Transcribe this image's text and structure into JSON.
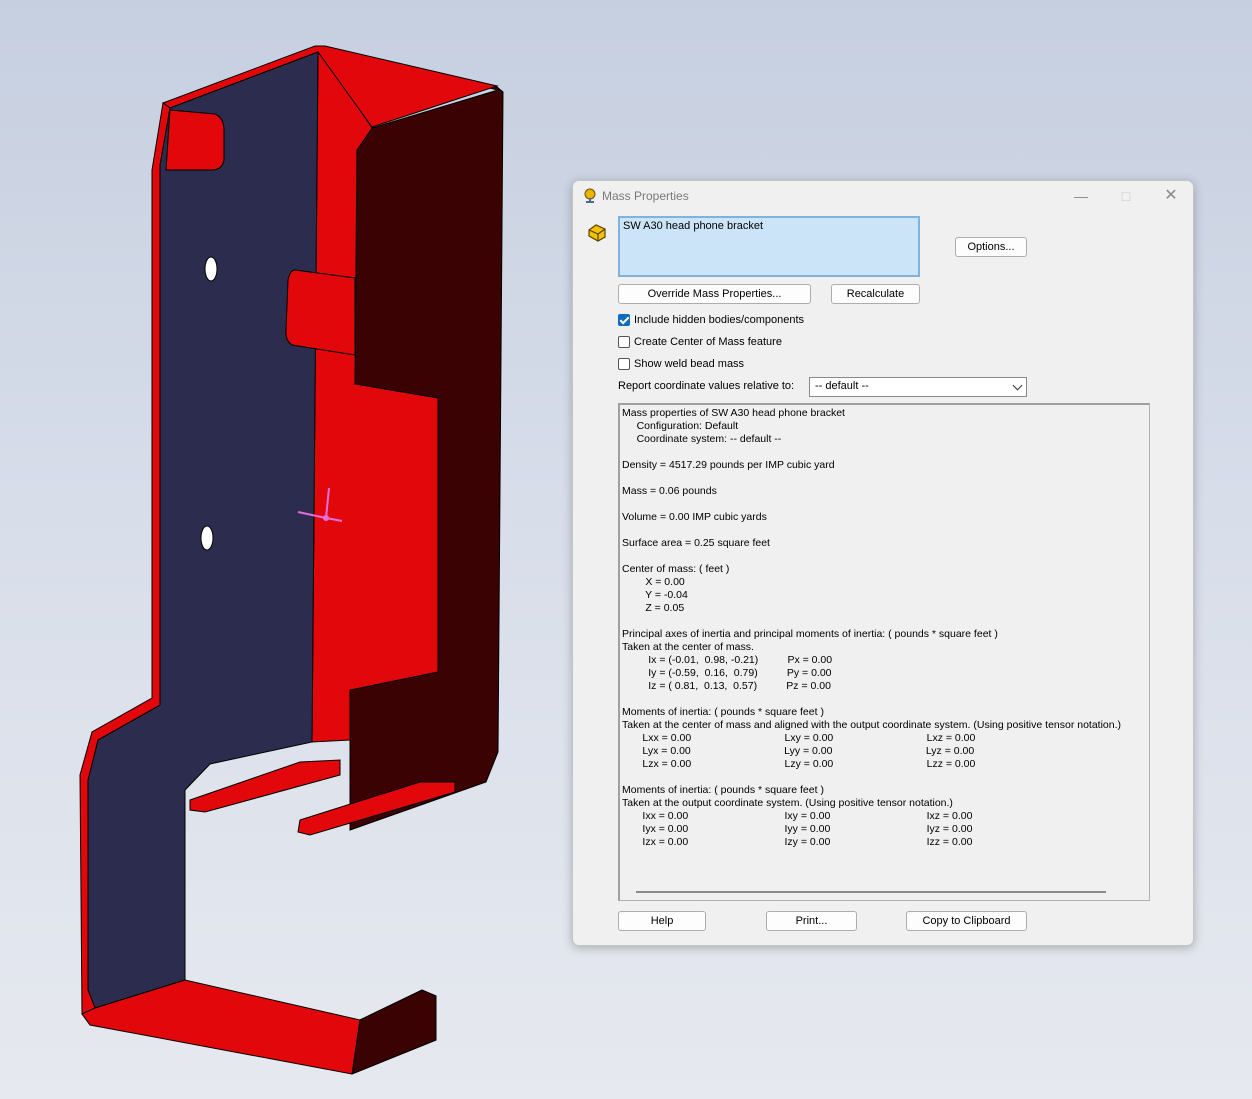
{
  "colors": {
    "part_face_red": "#e2070a",
    "part_face_dark": "#2c2c4e",
    "part_shadow": "#3a0203",
    "checkbox_accent": "#0f6cbd",
    "name_box_bg": "#cce4f7"
  },
  "window": {
    "title": "Mass Properties",
    "icons": {
      "title": "scale-icon",
      "minimize": "minimize-icon",
      "maximize": "maximize-icon",
      "close": "close-icon"
    }
  },
  "selection": {
    "icon": "part-icon",
    "items": [
      "SW A30 head phone bracket"
    ]
  },
  "buttons": {
    "options": "Options...",
    "override": "Override Mass Properties...",
    "recalculate": "Recalculate",
    "help": "Help",
    "print": "Print...",
    "copy": "Copy to Clipboard"
  },
  "options": {
    "include_hidden": {
      "label": "Include hidden bodies/components",
      "checked": true
    },
    "create_com": {
      "label": "Create Center of Mass feature",
      "checked": false
    },
    "weld_bead": {
      "label": "Show weld bead mass",
      "checked": false
    }
  },
  "report": {
    "label": "Report coordinate values relative to:",
    "selected": "-- default --"
  },
  "results": {
    "lines": [
      "Mass properties of SW A30 head phone bracket",
      "     Configuration: Default",
      "     Coordinate system: -- default --",
      "",
      "Density = 4517.29 pounds per IMP cubic yard",
      "",
      "Mass = 0.06 pounds",
      "",
      "Volume = 0.00 IMP cubic yards",
      "",
      "Surface area = 0.25 square feet",
      "",
      "Center of mass: ( feet )",
      "        X = 0.00",
      "        Y = -0.04",
      "        Z = 0.05",
      "",
      "Principal axes of inertia and principal moments of inertia: ( pounds * square feet )",
      "Taken at the center of mass.",
      "         Ix = (-0.01,  0.98, -0.21)          Px = 0.00",
      "         Iy = (-0.59,  0.16,  0.79)          Py = 0.00",
      "         Iz = ( 0.81,  0.13,  0.57)          Pz = 0.00",
      "",
      "Moments of inertia: ( pounds * square feet )",
      "Taken at the center of mass and aligned with the output coordinate system. (Using positive tensor notation.)",
      "       Lxx = 0.00                                Lxy = 0.00                                Lxz = 0.00",
      "       Lyx = 0.00                                Lyy = 0.00                                Lyz = 0.00",
      "       Lzx = 0.00                                Lzy = 0.00                                Lzz = 0.00",
      "",
      "Moments of inertia: ( pounds * square feet )",
      "Taken at the output coordinate system. (Using positive tensor notation.)",
      "       Ixx = 0.00                                 Ixy = 0.00                                 Ixz = 0.00",
      "       Iyx = 0.00                                 Iyy = 0.00                                 Iyz = 0.00",
      "       Izx = 0.00                                 Izy = 0.00                                 Izz = 0.00"
    ]
  }
}
